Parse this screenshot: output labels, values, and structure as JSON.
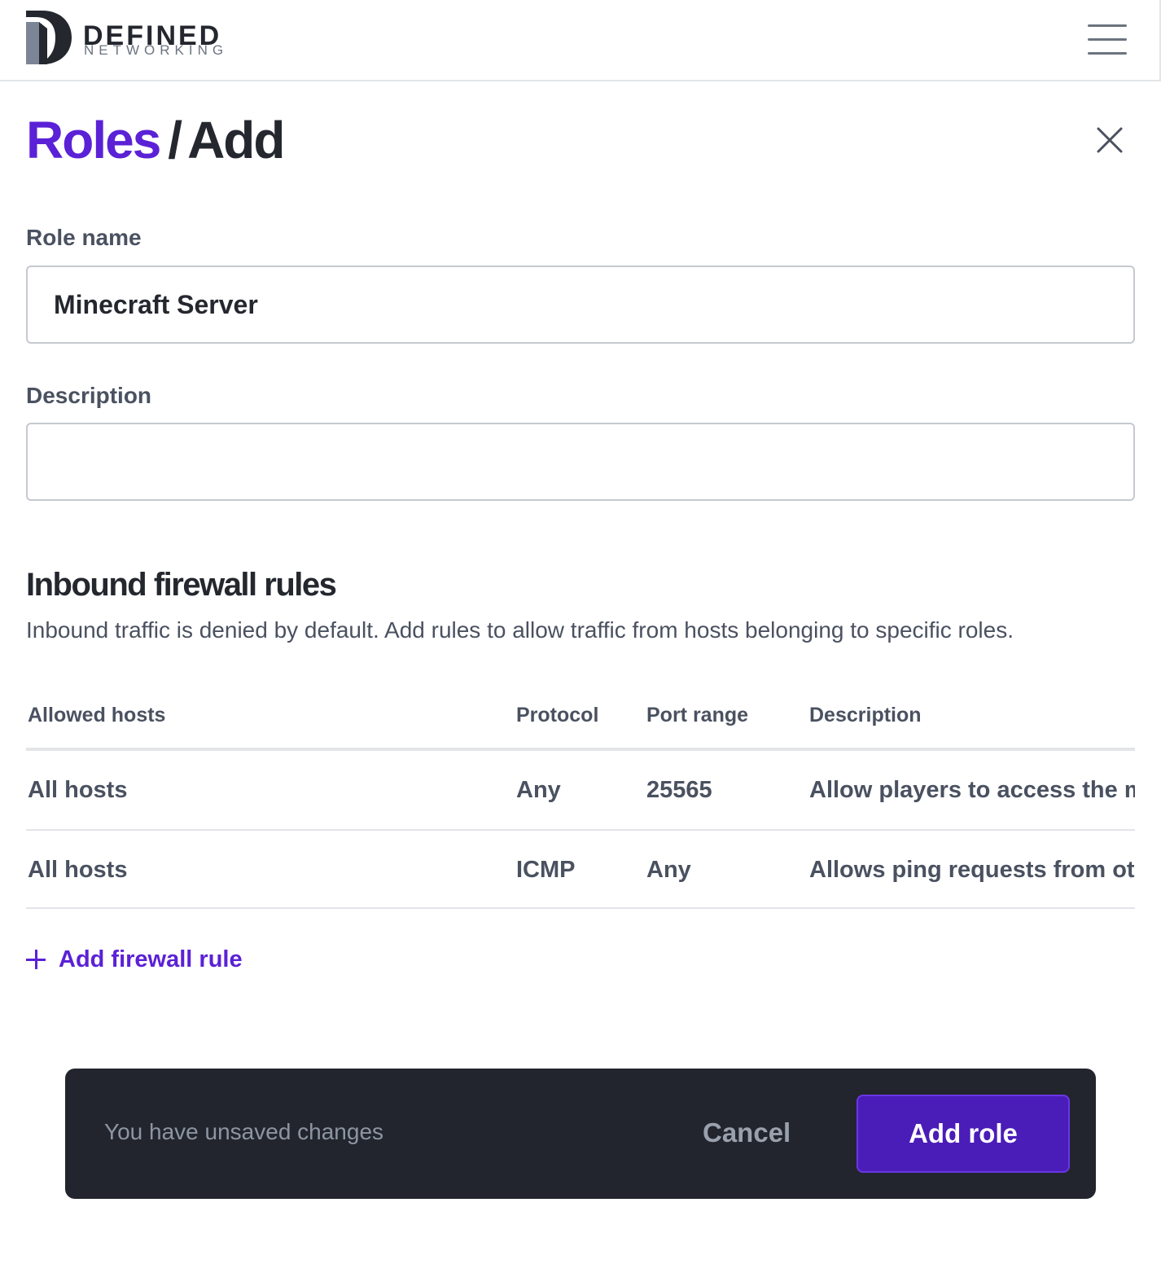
{
  "header": {
    "brand_line1": "DEFINED",
    "brand_line2": "NETWORKING",
    "menu_icon": "hamburger-menu-icon"
  },
  "title": {
    "breadcrumb": "Roles",
    "separator": "/",
    "current": "Add",
    "close_icon": "close-icon"
  },
  "form": {
    "role_name_label": "Role name",
    "role_name_value": "Minecraft Server",
    "description_label": "Description",
    "description_value": ""
  },
  "firewall": {
    "title": "Inbound firewall rules",
    "description": "Inbound traffic is denied by default. Add rules to allow traffic from hosts belonging to specific roles.",
    "columns": [
      "Allowed hosts",
      "Protocol",
      "Port range",
      "Description"
    ],
    "rows": [
      {
        "hosts": "All hosts",
        "protocol": "Any",
        "ports": "25565",
        "description": "Allow players to access the m"
      },
      {
        "hosts": "All hosts",
        "protocol": "ICMP",
        "ports": "Any",
        "description": "Allows ping requests from oth"
      }
    ],
    "add_rule_label": "Add firewall rule",
    "add_rule_icon": "plus-icon"
  },
  "savebar": {
    "message": "You have unsaved changes",
    "cancel_label": "Cancel",
    "submit_label": "Add role"
  },
  "colors": {
    "accent": "#5b21d6",
    "primary_button": "#4a1cb8",
    "dark_bar": "#22252d",
    "text": "#24272e",
    "muted": "#4a5160"
  }
}
